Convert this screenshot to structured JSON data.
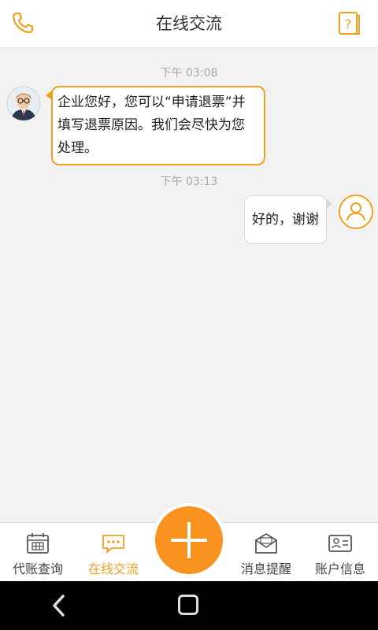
{
  "header": {
    "title": "在线交流",
    "phone_icon": "phone-icon",
    "help_icon": "help-book-icon"
  },
  "chat": {
    "messages": [
      {
        "timestamp": "下午 03:08",
        "side": "left",
        "text": "企业您好，您可以“申请退票”并填写退票原因。我们会尽快为您处理。"
      },
      {
        "timestamp": "下午 03:13",
        "side": "right",
        "text": "好的，谢谢"
      }
    ]
  },
  "tabbar": {
    "tabs": [
      {
        "label": "代账查询",
        "icon": "calendar-icon",
        "active": false
      },
      {
        "label": "在线交流",
        "icon": "chat-bubble-icon",
        "active": true
      },
      {
        "label": "消息提醒",
        "icon": "envelope-icon",
        "active": false
      },
      {
        "label": "账户信息",
        "icon": "id-card-icon",
        "active": false
      }
    ],
    "fab_icon": "plus-icon"
  },
  "colors": {
    "accent": "#f0a020",
    "fab": "#f7931e",
    "background": "#f2f2f2"
  }
}
